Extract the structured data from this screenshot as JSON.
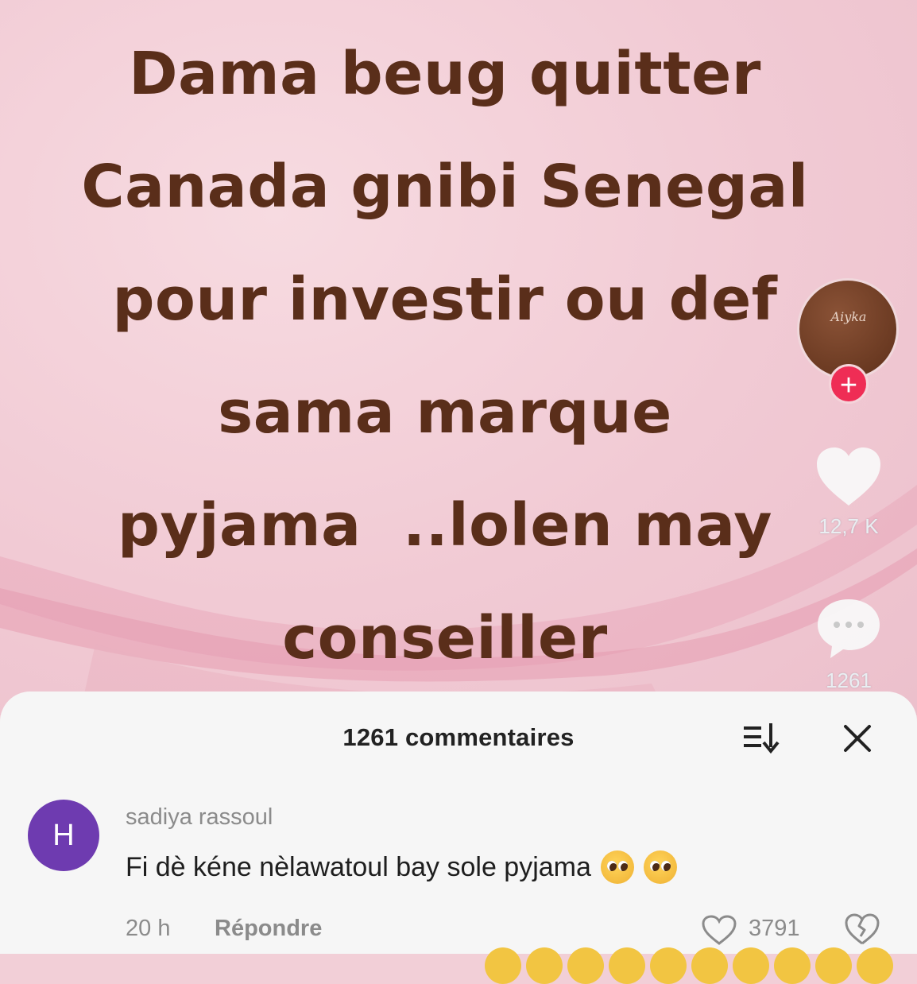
{
  "video": {
    "caption_lines": [
      "Dama beug quitter",
      "Canada gnibi Senegal",
      "pour investir ou def",
      "sama marque",
      "pyjama  ..lolen may",
      "conseiller"
    ],
    "creator_logo_text": "Aiyka",
    "like_count": "12,7 K",
    "comment_count": "1261"
  },
  "comments_sheet": {
    "title": "1261 commentaires",
    "comment": {
      "avatar_letter": "H",
      "username": "sadiya rassoul",
      "text": "Fi dè kéne nèlawatoul bay sole pyjama",
      "emoji_count": 2,
      "time": "20 h",
      "reply_label": "Répondre",
      "like_count": "3791"
    }
  },
  "colors": {
    "background_pink": "#f2cfd7",
    "caption_brown": "#5a2e1a",
    "follow_red": "#ef2d55",
    "avatar_purple": "#6e3bb0",
    "sheet_bg": "#f6f6f6"
  }
}
